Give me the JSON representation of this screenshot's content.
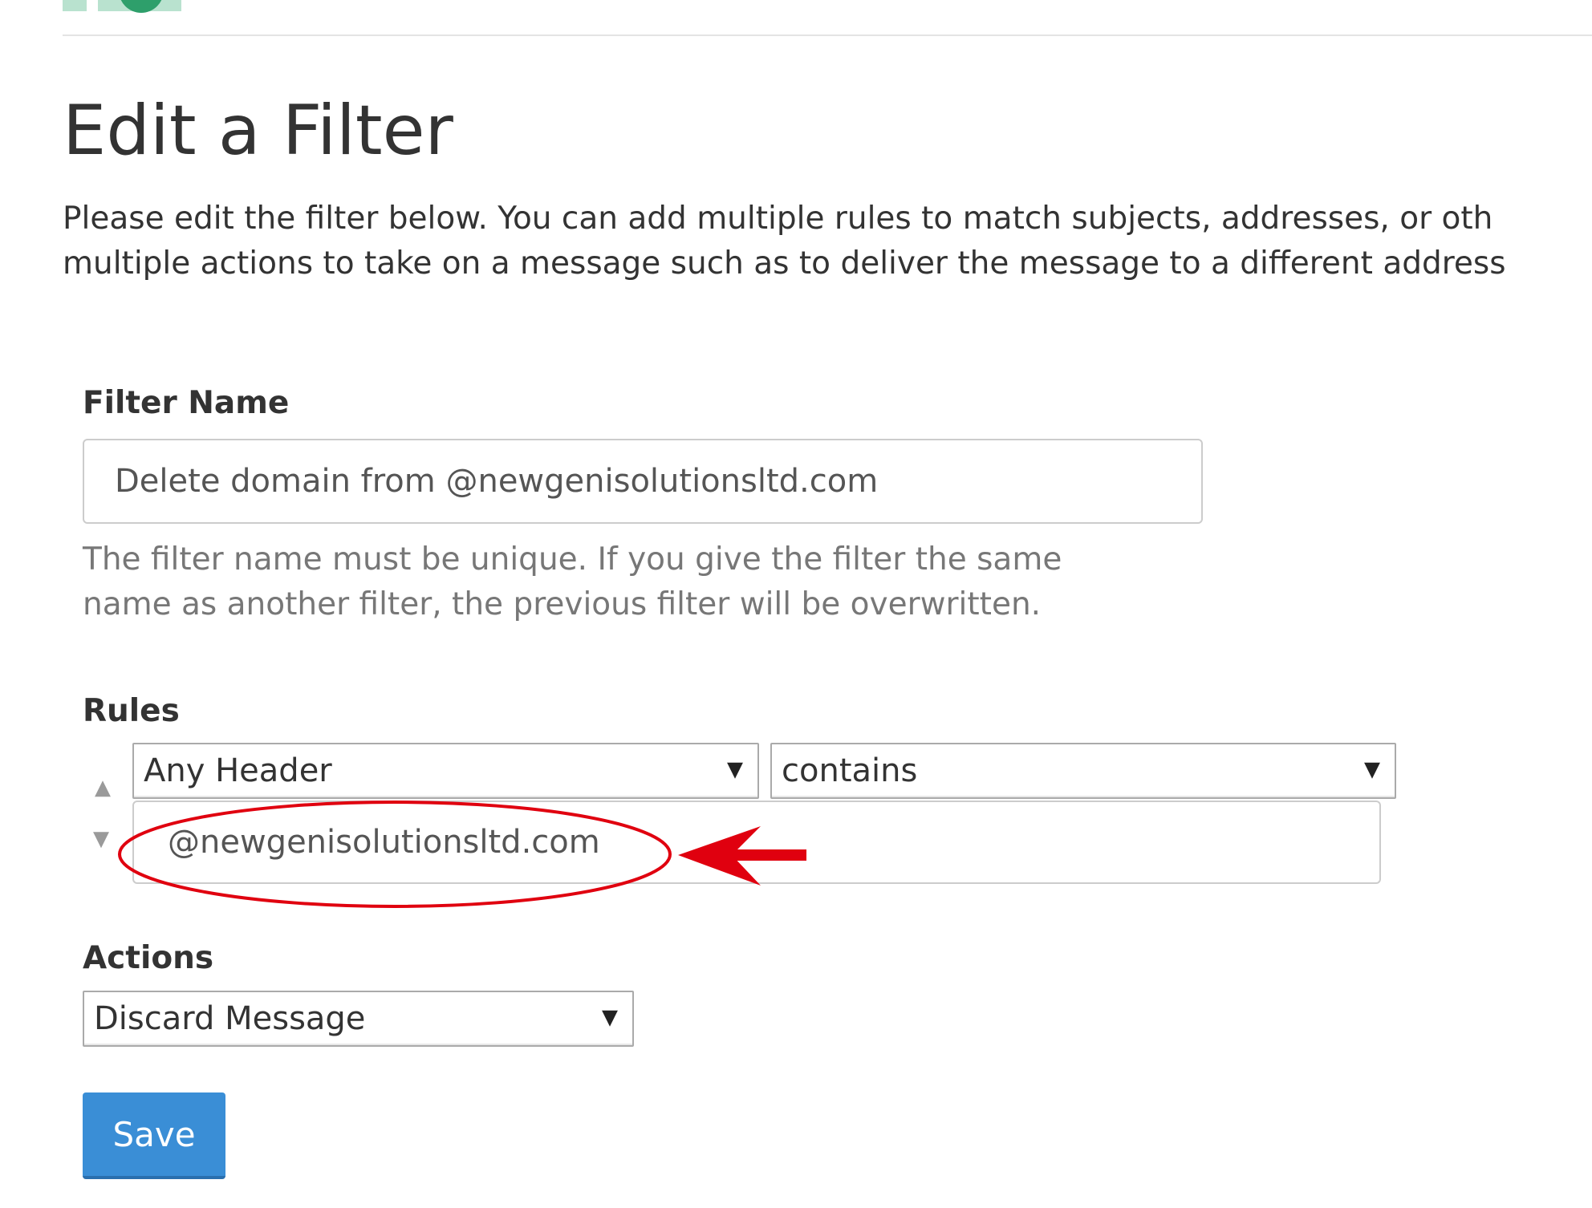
{
  "page": {
    "title": "Edit a Filter",
    "intro_line1": "Please edit the filter below. You can add multiple rules to match subjects, addresses, or oth",
    "intro_line2": "multiple actions to take on a message such as to deliver the message to a different address"
  },
  "filter_name": {
    "label": "Filter Name",
    "value": "Delete domain from @newgenisolutionsltd.com",
    "help_line1": "The filter name must be unique. If you give the filter the same",
    "help_line2": "name as another filter, the previous filter will be overwritten."
  },
  "rules": {
    "label": "Rules",
    "header_select": "Any Header",
    "match_select": "contains",
    "value": "@newgenisolutionsltd.com"
  },
  "actions": {
    "label": "Actions",
    "action_select": "Discard Message"
  },
  "save_label": "Save",
  "colors": {
    "primary_button": "#3a8ed6",
    "annotation": "#e0000f"
  },
  "icons": {
    "move_up": "triangle-up-icon",
    "move_down": "triangle-down-icon",
    "dropdown": "caret-down-icon"
  }
}
